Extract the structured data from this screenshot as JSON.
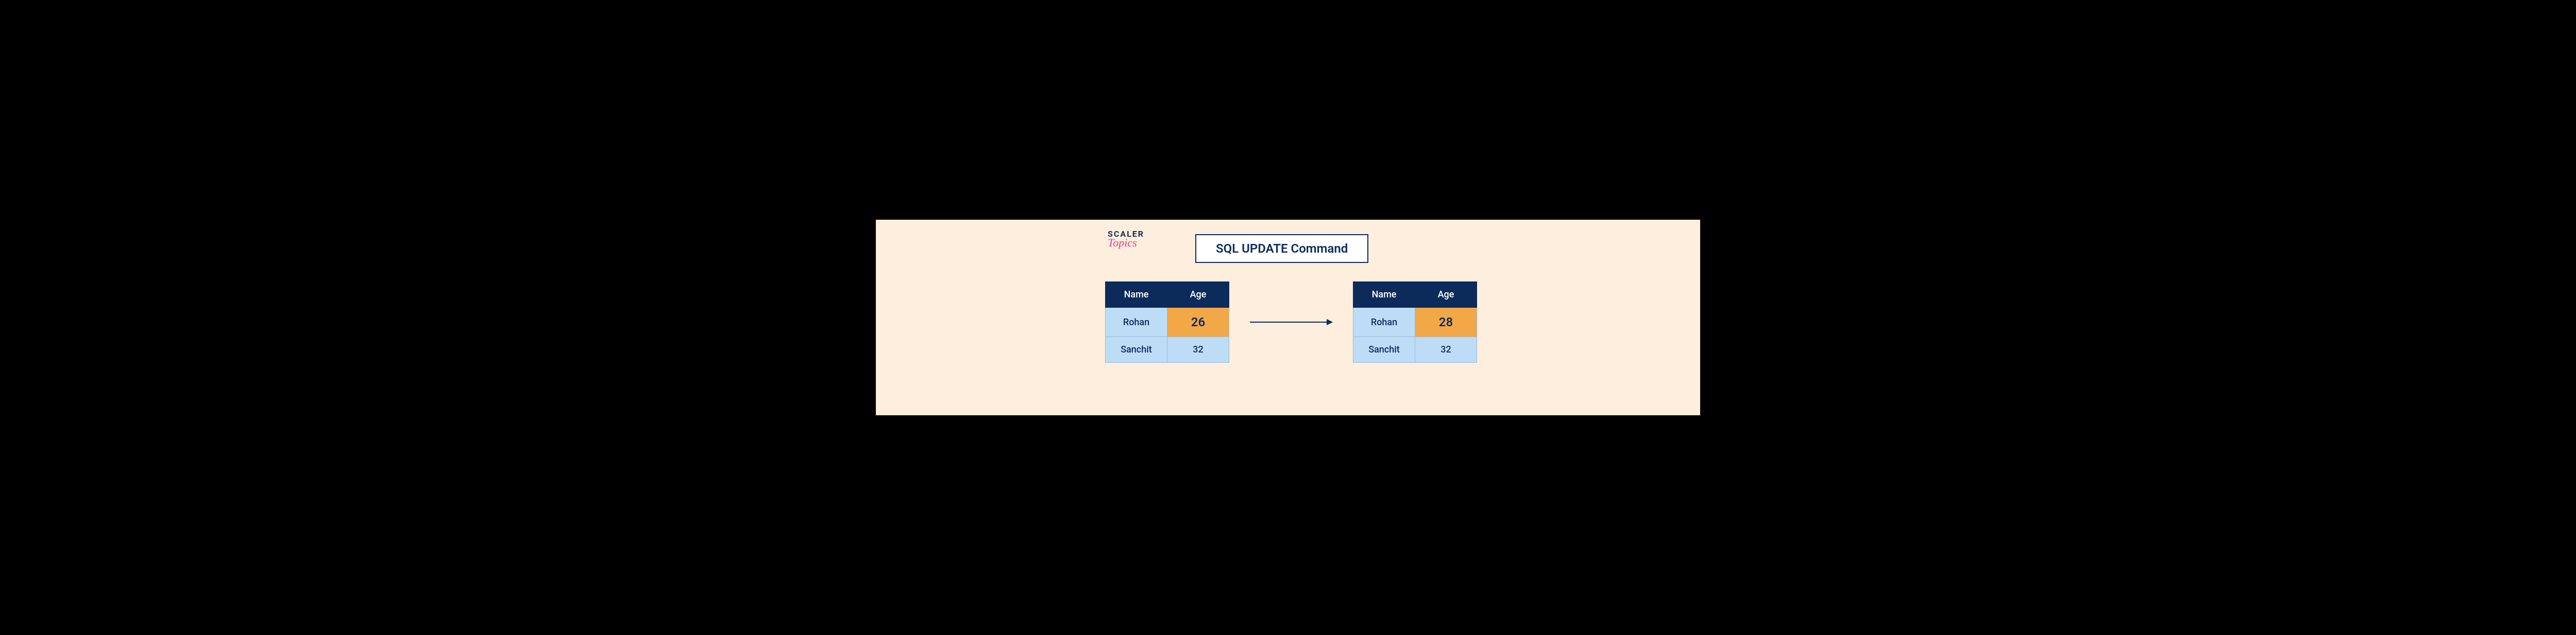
{
  "logo": {
    "line1": "SCALER",
    "line2": "Topics"
  },
  "title": "SQL UPDATE Command",
  "tables": {
    "before": {
      "headers": [
        "Name",
        "Age"
      ],
      "rows": [
        {
          "name": "Rohan",
          "age": "26",
          "highlight": true
        },
        {
          "name": "Sanchit",
          "age": "32",
          "highlight": false
        }
      ]
    },
    "after": {
      "headers": [
        "Name",
        "Age"
      ],
      "rows": [
        {
          "name": "Rohan",
          "age": "28",
          "highlight": true
        },
        {
          "name": "Sanchit",
          "age": "32",
          "highlight": false
        }
      ]
    }
  }
}
